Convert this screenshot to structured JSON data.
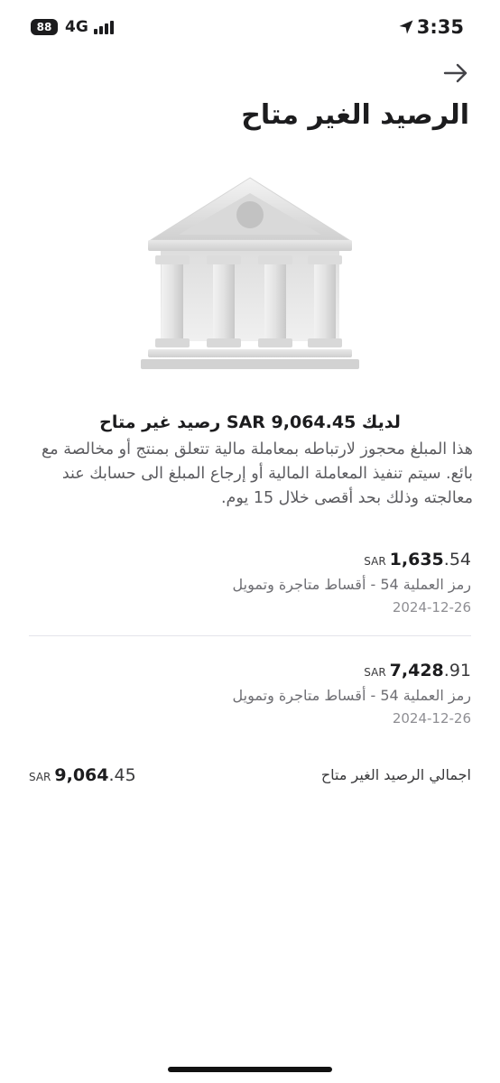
{
  "status_bar": {
    "battery": "88",
    "network": "4G",
    "time": "3:35",
    "icons": [
      "signal-bars-icon",
      "location-arrow-icon"
    ]
  },
  "header": {
    "back_icon": "arrow-right-icon",
    "title": "الرصيد الغير متاح"
  },
  "illustration": {
    "icon": "bank-building-icon"
  },
  "summary": {
    "headline": "لديك SAR 9,064.45 رصيد غير متاح",
    "description": "هذا المبلغ محجوز لارتباطه بمعاملة مالية تتعلق بمنتج أو مخالصة مع بائع. سيتم تنفيذ المعاملة المالية أو إرجاع المبلغ الى حسابك عند معالجته وذلك بحد أقصى خلال 15 يوم."
  },
  "transactions": [
    {
      "currency": "SAR",
      "amount_whole": "1,635",
      "amount_decimal": ".54",
      "description": "رمز العملية 54 - أقساط متاجرة وتمويل",
      "date": "2024-12-26"
    },
    {
      "currency": "SAR",
      "amount_whole": "7,428",
      "amount_decimal": ".91",
      "description": "رمز العملية 54 - أقساط متاجرة وتمويل",
      "date": "2024-12-26"
    }
  ],
  "total": {
    "label": "اجمالي الرصيد الغير متاح",
    "currency": "SAR",
    "amount_whole": "9,064",
    "amount_decimal": ".45"
  },
  "colors": {
    "text_primary": "#1c1c1e",
    "text_secondary": "#6e6e73",
    "divider": "#e4e4ea",
    "background": "#ffffff"
  }
}
